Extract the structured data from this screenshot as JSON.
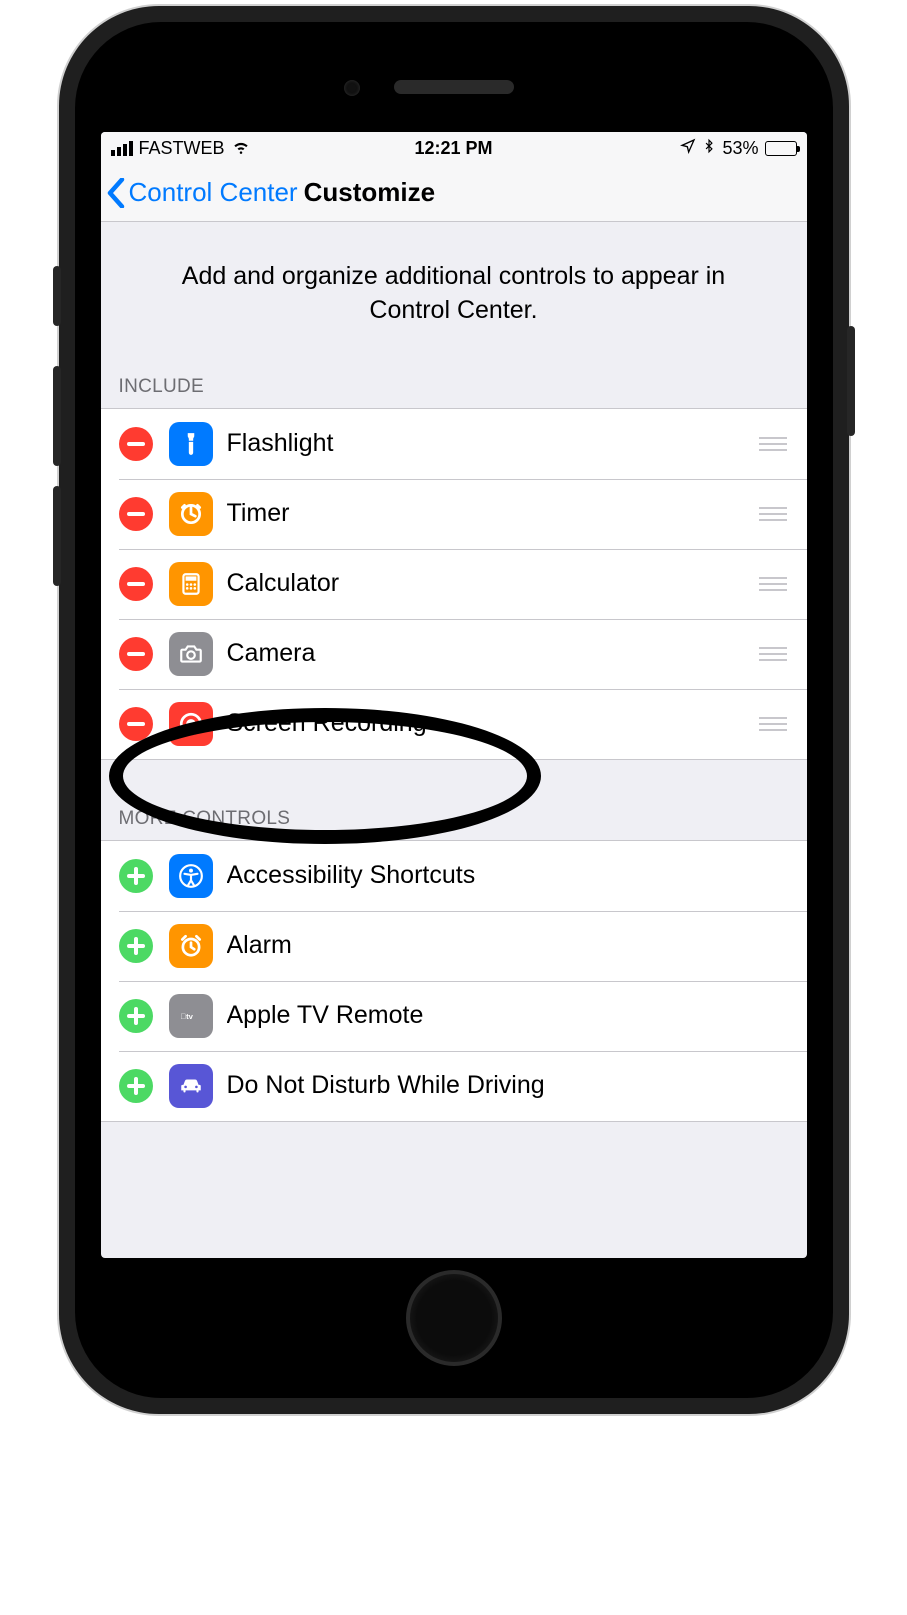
{
  "status": {
    "carrier": "FASTWEB",
    "time": "12:21 PM",
    "battery_pct": "53%"
  },
  "nav": {
    "back_label": "Control Center",
    "title": "Customize"
  },
  "description": "Add and organize additional controls to appear in Control Center.",
  "sections": {
    "include_header": "Include",
    "more_header": "More Controls"
  },
  "include": [
    {
      "label": "Flashlight",
      "icon": "flashlight",
      "icon_bg": "#007aff"
    },
    {
      "label": "Timer",
      "icon": "timer",
      "icon_bg": "#ff9500"
    },
    {
      "label": "Calculator",
      "icon": "calculator",
      "icon_bg": "#ff9500"
    },
    {
      "label": "Camera",
      "icon": "camera",
      "icon_bg": "#8e8e93"
    },
    {
      "label": "Screen Recording",
      "icon": "record",
      "icon_bg": "#ff3b30"
    }
  ],
  "more": [
    {
      "label": "Accessibility Shortcuts",
      "icon": "accessibility",
      "icon_bg": "#007aff"
    },
    {
      "label": "Alarm",
      "icon": "alarm",
      "icon_bg": "#ff9500"
    },
    {
      "label": "Apple TV Remote",
      "icon": "appletv",
      "icon_bg": "#8e8e93"
    },
    {
      "label": "Do Not Disturb While Driving",
      "icon": "car",
      "icon_bg": "#5856d6"
    }
  ],
  "annotation": {
    "highlighted_item": "Screen Recording"
  }
}
